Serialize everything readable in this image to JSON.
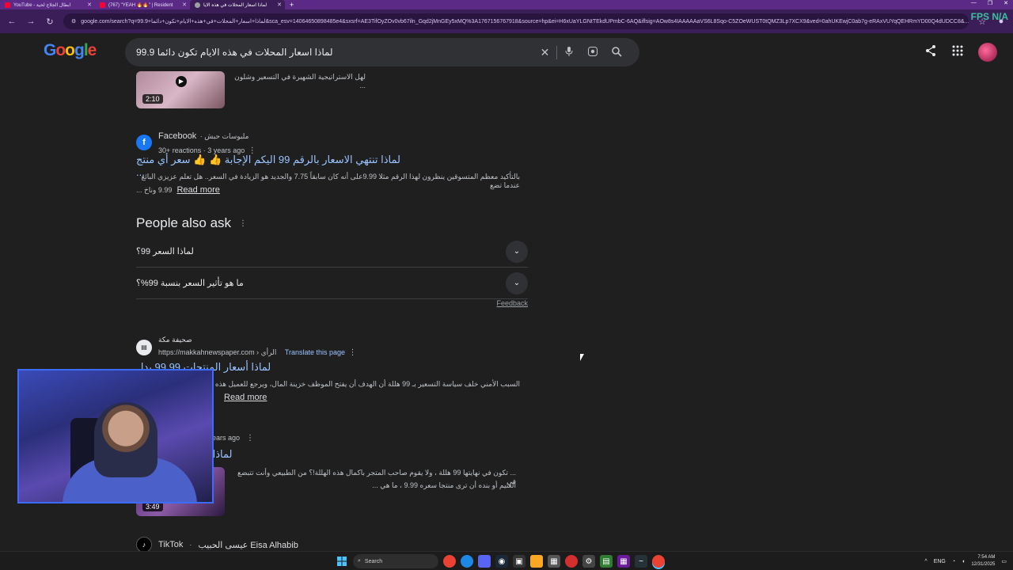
{
  "browser": {
    "tabs": [
      {
        "title": "YouTube - ابطال الجلاج لحية",
        "icon": "youtube-icon",
        "color": "#ff0033",
        "active": false
      },
      {
        "title": "(767) \"YEAH 🔥🔥\" | Resident",
        "icon": "youtube-icon",
        "color": "#ff0033",
        "active": false
      },
      {
        "title": "لماذا اسعار المحلات في هذه الايا",
        "icon": "google-icon",
        "color": "#9aa0a6",
        "active": true
      }
    ],
    "url": "google.com/search?q=99.9+لماذا+اسعار+المحلات+في+هذه+الايام+تكون+دائما&sca_esv=14064650898485e4&sxsrf=AE3TifOyZOv0vb67iln_Gqd2jMnGEy5xMQ%3A1767156767918&source=hp&ei=H6xUaYLGNtTEkdUPmbC-6AQ&iflsig=AOw8s4IAAAAAaVS6L8Sqo-C5ZOeWUST0tQMZ3Lp7XCX9&ved=0ahUKEwjC0ab7g-eRAxVUYqQEHRmYD00Q4dUDCC8&...",
    "overlay": "FPS N/A"
  },
  "search": {
    "logo": [
      "G",
      "o",
      "o",
      "g",
      "l",
      "e"
    ],
    "query": "99.9 لماذا اسعار المحلات في هذه الايام تكون دائما",
    "clear_icon": "✕",
    "mic_icon": "🎤"
  },
  "video_top": {
    "duration": "2:10",
    "snippet": "لهل الاستراتيجية الشهيرة في التسعير وشلون ..."
  },
  "facebook_result": {
    "site": "Facebook",
    "author": "ملبوسات حبش",
    "meta": "30+ reactions · 3 years ago",
    "title": "لماذا تنتهي الاسعار بالرقم 99 اليكم الإجابة 👍 👍 سعر أي منتج ...",
    "snippet1": "بالتأكيد معظم المتسوقين ينظرون لهذا الرقم مثلا 9.99على أنه كان سابقاً 7.75 والجديد هو الزيادة في السعر.. هل تعلم عزيزي البائع عندما تضع",
    "snippet2": "9.99 وناخ ...",
    "read_more": "Read more"
  },
  "paa": {
    "title": "People also ask",
    "questions": [
      "لماذا السعر 99؟",
      "ما هو تأثير السعر بنسبة 99%؟"
    ],
    "feedback": "Feedback"
  },
  "makkah_result": {
    "site": "صحيفة مكة",
    "url": "https://makkahnewspaper.com › الرأي",
    "translate": "Translate this page",
    "title": "لماذا أسعار المنتجات 99.99 بدل 100؟",
    "snippet": "السبب الأمني خلف سياسة التسعير بـ 99 هللة أن الهدف أن يفتح الموظف خزينة المال، ويرجع للعميل هذه الهللة، من",
    "read_more": "Read more"
  },
  "video_result": {
    "meta": "ears ago",
    "title": "لماذا أسعار المنتجات 9",
    "snippet1": "... تكون في نهايتها 99 هللة ، ولا يقوم صاحب المتجر باكمال هذه الهللة!؟ من الطبيعي وأنت تتبضع في",
    "snippet2": "العثيم أو بنده أن ترى منتجا سعره 9.99 ، ما هي ...",
    "duration": "3:49"
  },
  "tiktok_result": {
    "site": "TikTok",
    "author": "عيسى الحبيب Eisa Alhabib"
  },
  "taskbar": {
    "search_label": "Search",
    "time": "7:54 AM",
    "date": "12/31/2025",
    "lang": "ENG"
  }
}
